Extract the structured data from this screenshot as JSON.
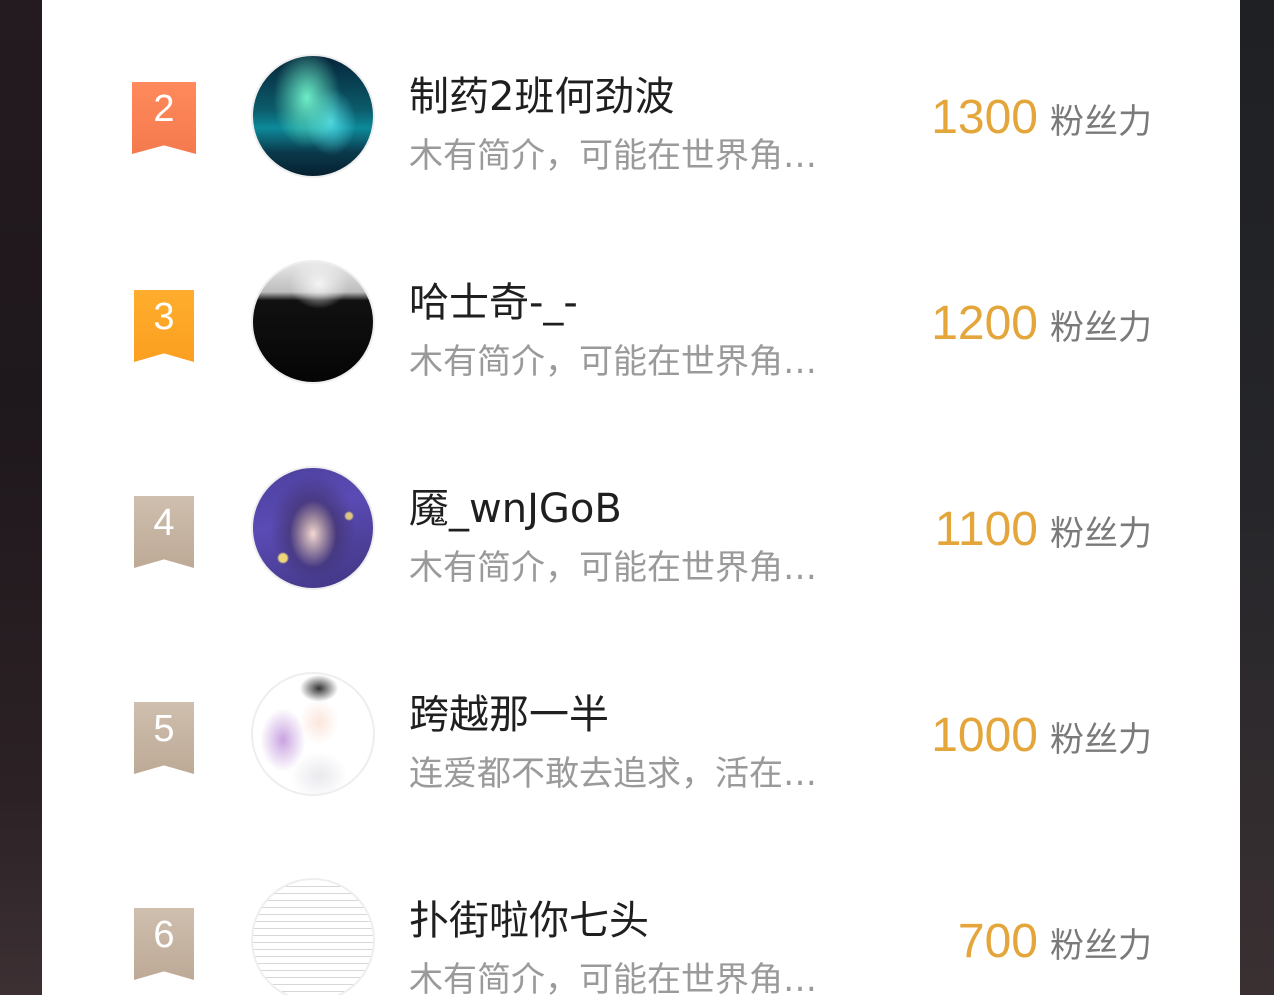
{
  "ranking": {
    "unit_label": "粉丝力",
    "rows": [
      {
        "rank": "2",
        "name": "制药2班何劲波",
        "bio": "木有简介，可能在世界角…",
        "score": "1300",
        "avatar": "aurora-avatar"
      },
      {
        "rank": "3",
        "name": "哈士奇-_-",
        "bio": "木有简介，可能在世界角…",
        "score": "1200",
        "avatar": "black-white-avatar"
      },
      {
        "rank": "4",
        "name": "魇_wnJGoB",
        "bio": "木有简介，可能在世界角…",
        "score": "1100",
        "avatar": "anime-girl-avatar"
      },
      {
        "rank": "5",
        "name": "跨越那一半",
        "bio": "连爱都不敢去追求，活在…",
        "score": "1000",
        "avatar": "anime-cat-girl-avatar"
      },
      {
        "rank": "6",
        "name": "扑街啦你七头",
        "bio": "木有简介，可能在世界角…",
        "score": "700",
        "avatar": "text-screenshot-avatar"
      }
    ]
  },
  "colors": {
    "rank_2": "#f47a4e",
    "rank_3": "#fb9f1f",
    "rank_other": "#c4b09c",
    "score": "#e4a63a"
  }
}
